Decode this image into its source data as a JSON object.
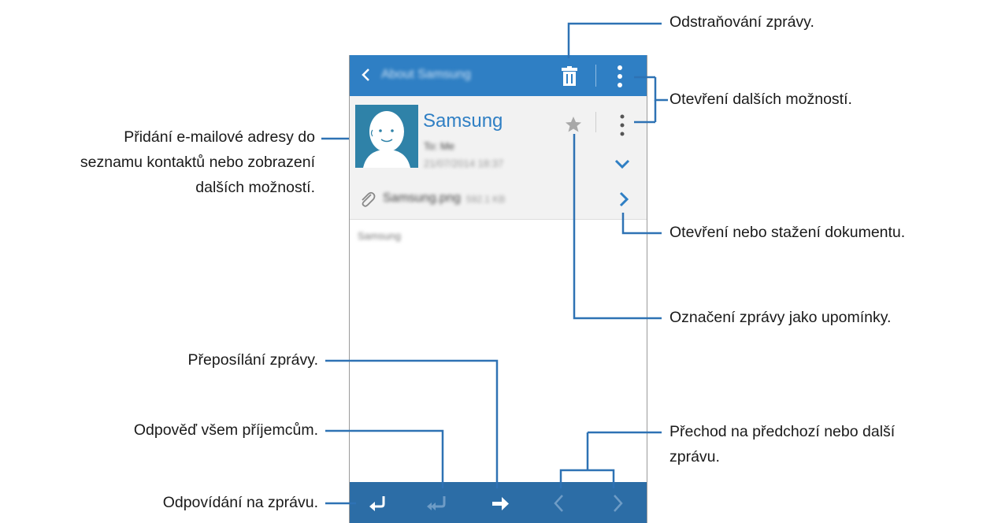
{
  "email_app": {
    "top_bar": {
      "title": "About Samsung"
    },
    "header": {
      "sender_name": "Samsung",
      "recipient": "To: Me",
      "date": "21/07/2014 18:37"
    },
    "attachment": {
      "file_name": "Samsung.png",
      "file_size": "592.1 KB"
    },
    "body": {
      "text": "Samsung"
    }
  },
  "callouts": {
    "delete": "Odstraňování zprávy.",
    "more_options": "Otevření dalších možností.",
    "add_contact_line1": "Přidání e-mailové adresy do",
    "add_contact_line2": "seznamu kontaktů nebo zobrazení",
    "add_contact_line3": "dalších možností.",
    "open_document": "Otevření nebo stažení dokumentu.",
    "mark_reminder": "Označení zprávy jako upomínky.",
    "forward": "Přeposílání zprávy.",
    "reply_all": "Odpověď všem příjemcům.",
    "prev_next_line1": "Přechod na předchozí nebo další",
    "prev_next_line2": "zprávu.",
    "reply": "Odpovídání na zprávu."
  },
  "colors": {
    "top_bar": "#2f7fc4",
    "bottom_bar": "#2c6da6",
    "sender_name": "#2f7fc4",
    "leader_lines": "#2e72b4"
  }
}
